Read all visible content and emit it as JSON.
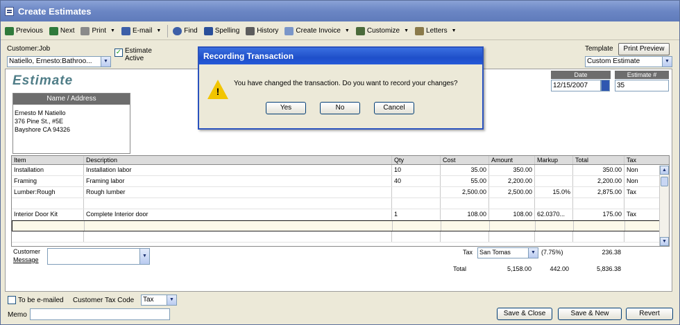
{
  "window": {
    "title": "Create Estimates"
  },
  "toolbar": {
    "items": [
      {
        "label": "Previous",
        "icon": "previous-icon",
        "dropdown": false
      },
      {
        "label": "Next",
        "icon": "next-icon",
        "dropdown": false
      },
      {
        "label": "Print",
        "icon": "print-icon",
        "dropdown": true
      },
      {
        "label": "E-mail",
        "icon": "email-icon",
        "dropdown": true
      },
      {
        "label": "Find",
        "icon": "find-icon",
        "dropdown": false
      },
      {
        "label": "Spelling",
        "icon": "spelling-icon",
        "dropdown": false
      },
      {
        "label": "History",
        "icon": "history-icon",
        "dropdown": false
      },
      {
        "label": "Create Invoice",
        "icon": "create-invoice-icon",
        "dropdown": true
      },
      {
        "label": "Customize",
        "icon": "customize-icon",
        "dropdown": true
      },
      {
        "label": "Letters",
        "icon": "letters-icon",
        "dropdown": true
      }
    ]
  },
  "header": {
    "customer_job_label": "Customer:Job",
    "customer_job_value": "Natiello, Ernesto:Bathroo...",
    "estimate_active_label": "Estimate Active",
    "estimate_active_checked": true,
    "template_label": "Template",
    "print_preview_label": "Print Preview",
    "template_value": "Custom Estimate"
  },
  "form": {
    "title": "Estimate",
    "address_header": "Name / Address",
    "address_lines": [
      "Ernesto M Natiello",
      "376 Pine St., #5E",
      "Bayshore CA 94326"
    ],
    "date_label": "Date",
    "date_value": "12/15/2007",
    "estimate_no_label": "Estimate #",
    "estimate_no_value": "35"
  },
  "table": {
    "columns": [
      "Item",
      "Description",
      "Qty",
      "Cost",
      "Amount",
      "Markup",
      "Total",
      "Tax"
    ],
    "rows": [
      [
        "Installation",
        "Installation labor",
        "10",
        "35.00",
        "350.00",
        "",
        "350.00",
        "Non"
      ],
      [
        "Framing",
        "Framing labor",
        "40",
        "55.00",
        "2,200.00",
        "",
        "2,200.00",
        "Non"
      ],
      [
        "Lumber:Rough",
        "Rough lumber",
        "",
        "2,500.00",
        "2,500.00",
        "15.0%",
        "2,875.00",
        "Tax"
      ],
      [
        "",
        "",
        "",
        "",
        "",
        "",
        "",
        ""
      ],
      [
        "Interior Door Kit",
        "Complete Interior door",
        "1",
        "108.00",
        "108.00",
        "62.0370...",
        "175.00",
        "Tax"
      ],
      [
        "",
        "",
        "",
        "",
        "",
        "",
        "",
        ""
      ],
      [
        "",
        "",
        "",
        "",
        "",
        "",
        "",
        ""
      ]
    ]
  },
  "footer": {
    "customer_message_label_1": "Customer",
    "customer_message_label_2": "Message",
    "tax_label": "Tax",
    "tax_item": "San Tomas",
    "tax_rate": "(7.75%)",
    "tax_amount": "236.38",
    "total_label": "Total",
    "total_amount": "5,158.00",
    "total_markup": "442.00",
    "total_total": "5,836.38",
    "to_be_emailed_label": "To be e-mailed",
    "customer_tax_code_label": "Customer Tax Code",
    "customer_tax_code_value": "Tax",
    "memo_label": "Memo",
    "save_close_label": "Save & Close",
    "save_new_label": "Save & New",
    "revert_label": "Revert"
  },
  "dialog": {
    "title": "Recording Transaction",
    "message": "You have changed the transaction. Do you want to record your changes?",
    "yes_label": "Yes",
    "no_label": "No",
    "cancel_label": "Cancel"
  },
  "colors": {
    "titlebar": "#6b86c4",
    "dialog_titlebar": "#1e4fc9",
    "estimate_title": "#4f7d87",
    "warning": "#f2c500"
  }
}
